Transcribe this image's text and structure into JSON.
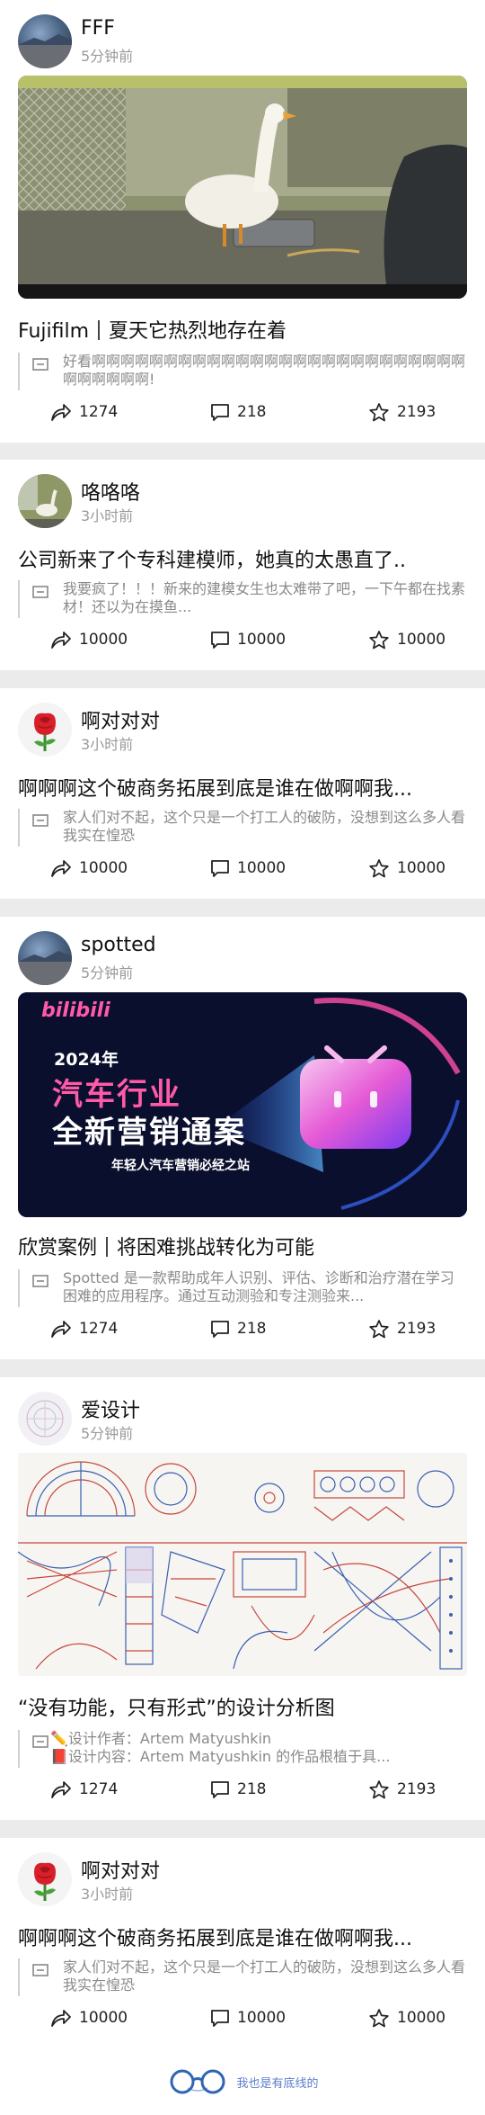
{
  "colors": {
    "page_bg": "#ebebeb",
    "card_bg": "#ffffff",
    "accent": "#2e66b4",
    "muted": "#9a9a9a"
  },
  "posts": [
    {
      "username": "FFF",
      "time": "5分钟前",
      "title_a": "Fujifilm",
      "title_b": "夏天它热烈地存在着",
      "quote": "好看啊啊啊啊啊啊啊啊啊啊啊啊啊啊啊啊啊啊啊啊啊啊啊啊啊啊啊啊啊啊啊啊!",
      "share": "1274",
      "comments": "218",
      "stars": "2193",
      "image": "photo-goose-in-cage"
    },
    {
      "username": "咯咯咯",
      "time": "3小时前",
      "title": "公司新来了个专科建模师，她真的太愚直了..",
      "quote": "我要疯了！！！新来的建模女生也太难带了吧，一下午都在找素材！还以为在摸鱼...",
      "share": "10000",
      "comments": "10000",
      "stars": "10000"
    },
    {
      "username": "啊对对对",
      "time": "3小时前",
      "title": "啊啊啊这个破商务拓展到底是谁在做啊啊我...",
      "quote": "家人们对不起，这个只是一个打工人的破防，没想到这么多人看我实在惶恐",
      "share": "10000",
      "comments": "10000",
      "stars": "10000"
    },
    {
      "username": "spotted",
      "time": "5分钟前",
      "title_a": "欣赏案例",
      "title_b": "将困难挑战转化为可能",
      "quote": "Spotted 是一款帮助成年人识别、评估、诊断和治疗潜在学习困难的应用程序。通过互动测验和专注测验来...",
      "share": "1274",
      "comments": "218",
      "stars": "2193",
      "banner": {
        "brand": "bilibili",
        "year": "2024年",
        "line1": "汽车行业",
        "line2": "全新营销通案",
        "tagline": "年轻人汽车营销必经之站"
      }
    },
    {
      "username": "爱设计",
      "time": "5分钟前",
      "title": "“没有功能，只有形式”的设计分析图",
      "quote_line1": "✏️设计作者：Artem Matyushkin",
      "quote_line2": "📕设计内容：Artem Matyushkin 的作品根植于具...",
      "share": "1274",
      "comments": "218",
      "stars": "2193",
      "image": "design-diagram-collage"
    },
    {
      "username": "啊对对对",
      "time": "3小时前",
      "title": "啊啊啊这个破商务拓展到底是谁在做啊啊我...",
      "quote": "家人们对不起，这个只是一个打工人的破防，没想到这么多人看我实在惶恐",
      "share": "10000",
      "comments": "10000",
      "stars": "10000"
    }
  ],
  "footer": {
    "text": "我也是有底线的",
    "icon": "glasses-icon"
  }
}
